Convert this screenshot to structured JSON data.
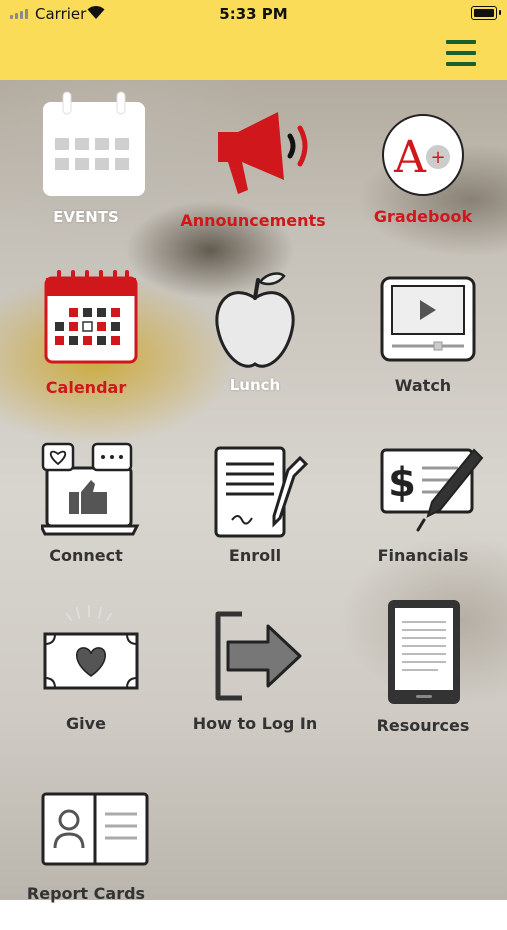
{
  "status_bar": {
    "carrier": "Carrier",
    "time": "5:33 PM"
  },
  "header": {
    "menu_icon": "hamburger-menu-icon",
    "background_color": "#fbdc58",
    "menu_color": "#1a5f2e"
  },
  "tiles": [
    {
      "label": "EVENTS",
      "icon": "calendar-icon"
    },
    {
      "label": "Announcements",
      "icon": "megaphone-icon"
    },
    {
      "label": "Gradebook",
      "icon": "grade-a-plus-icon"
    },
    {
      "label": "Calendar",
      "icon": "calendar-grid-icon"
    },
    {
      "label": "Lunch",
      "icon": "apple-icon"
    },
    {
      "label": "Watch",
      "icon": "video-player-icon"
    },
    {
      "label": "Connect",
      "icon": "laptop-chat-icon"
    },
    {
      "label": "Enroll",
      "icon": "document-pen-icon"
    },
    {
      "label": "Financials",
      "icon": "check-pen-icon"
    },
    {
      "label": "Give",
      "icon": "money-heart-icon"
    },
    {
      "label": "How to Log In",
      "icon": "login-arrow-icon"
    },
    {
      "label": "Resources",
      "icon": "tablet-icon"
    },
    {
      "label": "Report Cards",
      "icon": "report-card-book-icon"
    }
  ],
  "colors": {
    "accent_red": "#d0171b",
    "icon_dark": "#333333",
    "icon_white": "#ffffff"
  }
}
